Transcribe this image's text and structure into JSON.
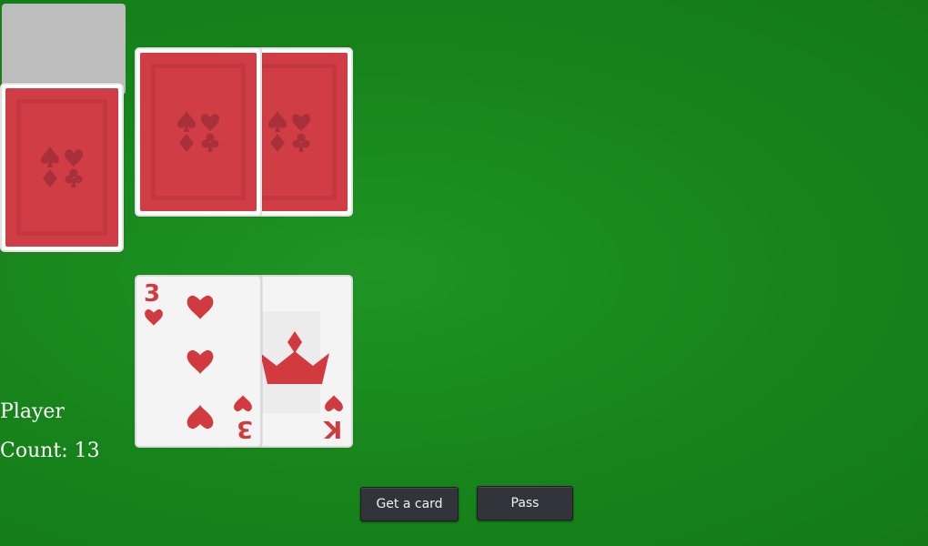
{
  "deck": {
    "card_back_color": "#d03d45"
  },
  "dealer": {
    "cards": [
      "face-down",
      "face-down"
    ]
  },
  "player": {
    "label": "Player",
    "count_label": "Count: 13",
    "cards": [
      {
        "rank": "3",
        "suit": "hearts"
      },
      {
        "rank": "K",
        "suit": "hearts"
      }
    ]
  },
  "actions": {
    "get_card_label": "Get a card",
    "pass_label": "Pass"
  },
  "colors": {
    "table": "#1a8a1e",
    "card_red": "#d13a3f",
    "button": "#33333b"
  }
}
